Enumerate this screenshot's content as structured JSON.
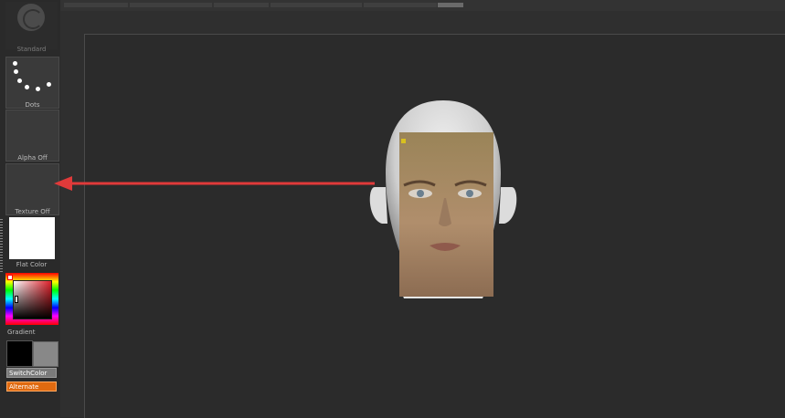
{
  "shelf": {
    "brush_label": "Standard",
    "stroke_label": "Dots",
    "alpha_label": "Alpha Off",
    "texture_label": "Texture Off",
    "material_label": "Flat Color",
    "gradient_label": "Gradient",
    "switch_color_label": "SwitchColor",
    "alternate_label": "Alternate"
  },
  "colors": {
    "main_color": "#000000",
    "secondary_color": "#888888",
    "alternate_button": "#e06a10",
    "arrow": "#e03a3a"
  },
  "icons": [
    "brush-icon",
    "stroke-dots-icon",
    "color-picker-icon",
    "annotation-arrow"
  ]
}
